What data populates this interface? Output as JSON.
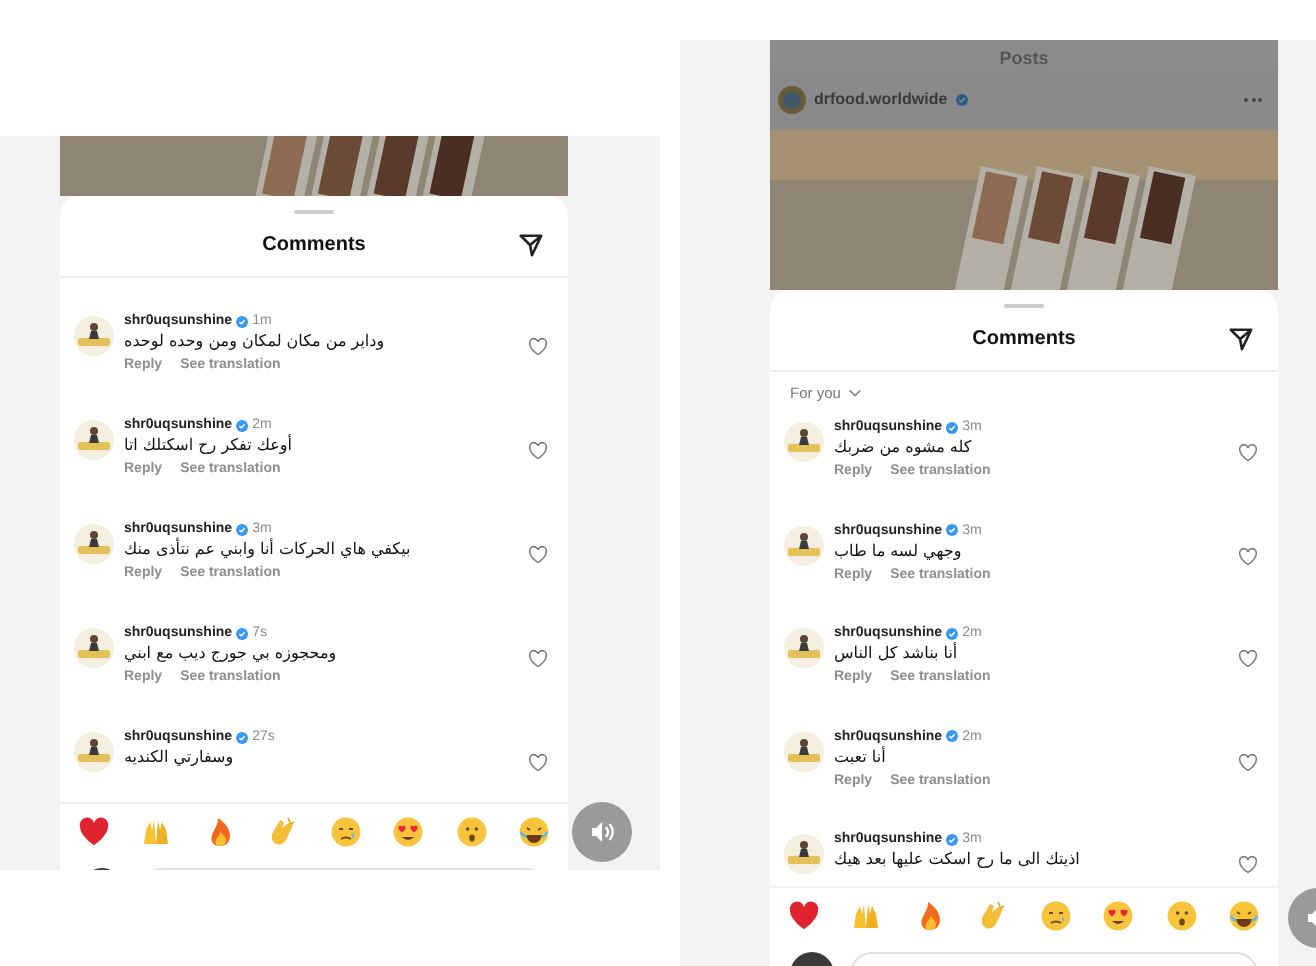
{
  "panels": [
    {
      "sheet_title": "Comments",
      "comments": [
        {
          "user": "shr0uqsunshine",
          "time": "1m",
          "text": "وداير من مكان لمكان ومن وحده لوحده",
          "reply": "Reply",
          "translate": "See translation",
          "liked": false
        },
        {
          "user": "shr0uqsunshine",
          "time": "2m",
          "text": "أوعك تفكر رح اسكتلك اتا",
          "reply": "Reply",
          "translate": "See translation",
          "liked": false
        },
        {
          "user": "shr0uqsunshine",
          "time": "3m",
          "text": "بيكفي هاي الحركات أنا وابني عم نتأذى منك",
          "reply": "Reply",
          "translate": "See translation",
          "liked": false
        },
        {
          "user": "shr0uqsunshine",
          "time": "7s",
          "text": "ومحجوزه بي جورج ديب مع ابني",
          "reply": "Reply",
          "translate": "See translation",
          "liked": false
        },
        {
          "user": "shr0uqsunshine",
          "time": "27s",
          "text": "وسفارتي الكنديه",
          "liked": false
        }
      ],
      "reactions": [
        {
          "kind": "heart"
        },
        {
          "kind": "raised-hands"
        },
        {
          "kind": "fire"
        },
        {
          "kind": "clap"
        },
        {
          "kind": "tear"
        },
        {
          "kind": "heart-eyes"
        },
        {
          "kind": "surprised"
        },
        {
          "kind": "laugh"
        }
      ]
    },
    {
      "post": {
        "title": "Posts",
        "account": "drfood.worldwide"
      },
      "sheet_title": "Comments",
      "filter": "For you",
      "comments": [
        {
          "user": "shr0uqsunshine",
          "time": "3m",
          "text": "كله مشوه من ضربك",
          "reply": "Reply",
          "translate": "See translation",
          "liked": false
        },
        {
          "user": "shr0uqsunshine",
          "time": "3m",
          "text": "وجهي لسه ما طاب",
          "reply": "Reply",
          "translate": "See translation",
          "liked": false
        },
        {
          "user": "shr0uqsunshine",
          "time": "2m",
          "text": "أنا بناشد كل الناس",
          "reply": "Reply",
          "translate": "See translation",
          "liked": false
        },
        {
          "user": "shr0uqsunshine",
          "time": "2m",
          "text": "أنا تعبت",
          "reply": "Reply",
          "translate": "See translation",
          "liked": false
        },
        {
          "user": "shr0uqsunshine",
          "time": "3m",
          "text": "اذيتك الى ما رح اسكت عليها بعد هيك",
          "liked": false
        }
      ],
      "reactions": [
        {
          "kind": "heart"
        },
        {
          "kind": "raised-hands"
        },
        {
          "kind": "fire"
        },
        {
          "kind": "clap"
        },
        {
          "kind": "tear"
        },
        {
          "kind": "heart-eyes"
        },
        {
          "kind": "surprised"
        },
        {
          "kind": "laugh"
        }
      ]
    }
  ]
}
